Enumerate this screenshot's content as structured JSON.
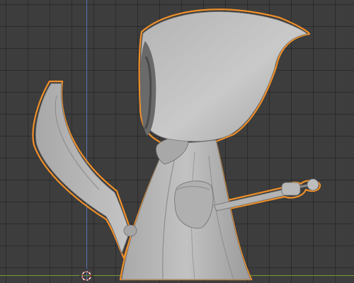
{
  "viewport": {
    "object_name": "grim-reaper-figure",
    "shading": "solid",
    "selection_state": "selected"
  },
  "colors": {
    "background": "#3d3d3d",
    "grid_line": "#2a2a2a",
    "axis_y": "#5a7fc0",
    "axis_x": "#7ca43a",
    "selection_outline": "#f0902a",
    "model_base": "#b9b9b9",
    "model_shadow": "#8e8e8e",
    "model_dark": "#555555"
  },
  "icons": {
    "cursor": "3d-cursor-icon"
  }
}
